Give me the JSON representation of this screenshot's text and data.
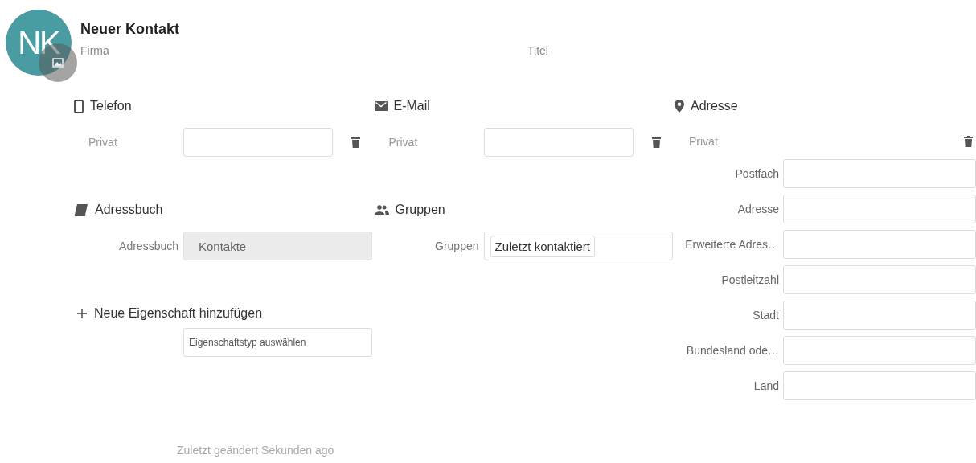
{
  "header": {
    "avatar_initials": "NK",
    "title": "Neuer Kontakt",
    "company_placeholder": "Firma",
    "title_placeholder": "Titel"
  },
  "phone": {
    "heading": "Telefon",
    "entries": [
      {
        "type": "Privat"
      }
    ]
  },
  "email": {
    "heading": "E-Mail",
    "entries": [
      {
        "type": "Privat"
      }
    ]
  },
  "address": {
    "heading": "Adresse",
    "entries": [
      {
        "type": "Privat",
        "fields": [
          "Postfach",
          "Adresse",
          "Erweiterte Adres…",
          "Postleitzahl",
          "Stadt",
          "Bundesland ode…",
          "Land"
        ]
      }
    ]
  },
  "addressbook": {
    "heading": "Adressbuch",
    "label": "Adressbuch",
    "value": "Kontakte",
    "disabled": true
  },
  "groups": {
    "heading": "Gruppen",
    "label": "Gruppen",
    "tags": [
      "Zuletzt kontaktiert"
    ]
  },
  "add_property": {
    "label": "Neue Eigenschaft hinzufügen",
    "placeholder": "Eigenschaftstyp auswählen"
  },
  "footer": "Zuletzt geändert Sekunden ago"
}
